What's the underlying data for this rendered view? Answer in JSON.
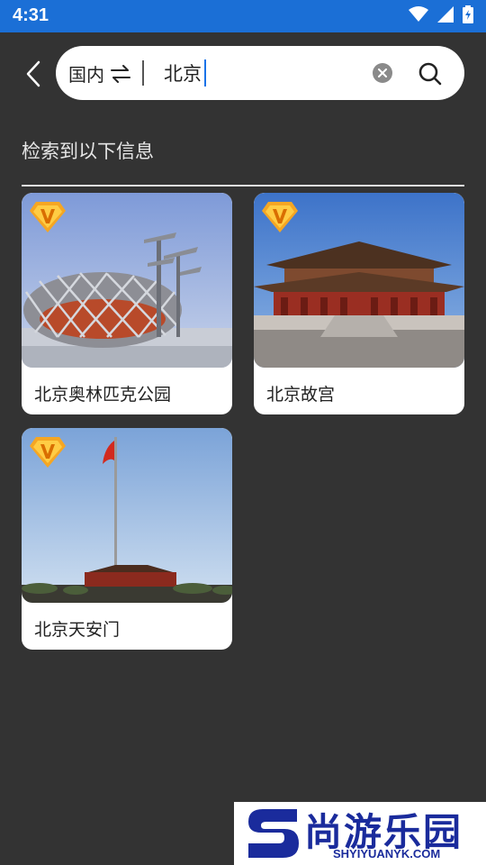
{
  "status_bar": {
    "time": "4:31"
  },
  "search": {
    "region": "国内",
    "region_switch_icon": "swap-icon",
    "query": "北京"
  },
  "results": {
    "heading": "检索到以下信息",
    "items": [
      {
        "title": "北京奥林匹克公园",
        "badge": "V"
      },
      {
        "title": "北京故宫",
        "badge": "V"
      },
      {
        "title": "北京天安门",
        "badge": "V"
      }
    ]
  },
  "watermark": {
    "name": "尚游乐园",
    "url": "SHYIYUANYK.COM"
  }
}
